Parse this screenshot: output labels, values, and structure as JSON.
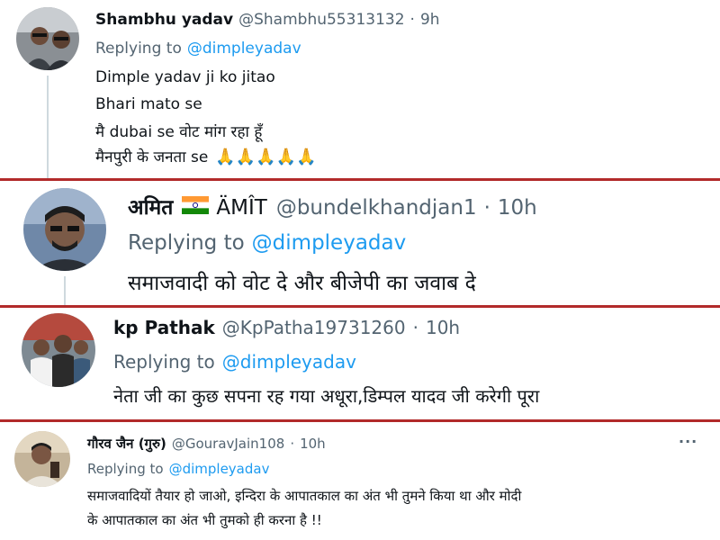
{
  "tweets": [
    {
      "name": "Shambhu yadav",
      "handle": "@Shambhu55313132",
      "dot": "·",
      "time": "9h",
      "replying_label": "Replying to",
      "replying_to": "@dimpleyadav",
      "lines": [
        "Dimple yadav ji ko jitao",
        "Bhari mato se",
        "मै dubai se वोट मांग रहा हूँ",
        "मैनपुरी के जनता se"
      ],
      "emoji": "🙏🙏🙏🙏🙏"
    },
    {
      "name_a": "अमित",
      "name_flag": "india-flag-icon",
      "name_b": "ÄMÎT",
      "handle": "@bundelkhandjan1",
      "dot": "·",
      "time": "10h",
      "replying_label": "Replying to",
      "replying_to": "@dimpleyadav",
      "lines": [
        "समाजवादी को वोट दे और बीजेपी का जवाब दे"
      ]
    },
    {
      "name": "kp Pathak",
      "handle": "@KpPatha19731260",
      "dot": "·",
      "time": "10h",
      "replying_label": "Replying to",
      "replying_to": "@dimpleyadav",
      "lines": [
        "नेता जी का कुछ सपना रह गया अधूरा,डिम्पल यादव जी करेगी पूरा"
      ]
    },
    {
      "name": "गौरव जैन (गुरु)",
      "handle": "@GouravJain108",
      "dot": "·",
      "time": "10h",
      "more": "···",
      "replying_label": "Replying to",
      "replying_to": "@dimpleyadav",
      "lines": [
        "समाजवादियों तैयार हो जाओ, इन्दिरा के आपातकाल का अंत भी तुमने किया था और मोदी",
        "के आपातकाल का अंत भी तुमको ही करना है !!"
      ]
    }
  ],
  "colors": {
    "divider": "#b22a2a",
    "link": "#1d9bf0",
    "muted": "#536471",
    "text": "#0f1419"
  }
}
